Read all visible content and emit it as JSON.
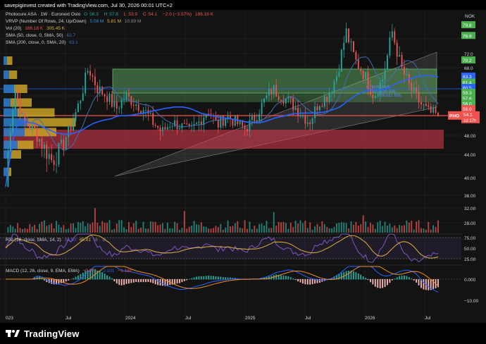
{
  "caption": "savepiginvest created with TradingView.com, Jul 30, 2026 00:01 UTC+2",
  "footer": {
    "brand": "TradingView"
  },
  "header": {
    "symbol": "Photocure ASA · 1W · Euronext Oslo",
    "ohlc": {
      "o_label": "O",
      "o": "56.3",
      "h_label": "H",
      "h": "57.8",
      "l_label": "L",
      "l": "53.9",
      "c_label": "C",
      "c": "54.1",
      "change": "−2.0 (−3.57%)",
      "vol": "186.18 K"
    },
    "vrvp": {
      "label": "VRVP (Number Of Rows, 24, Up/Down)",
      "v1": "5.08 M",
      "v2": "5.81 M",
      "v3": "10.89 M"
    },
    "vol": {
      "label": "Vol (20)",
      "v1": "186.18 K",
      "v2": "305.45 K"
    },
    "sma50": {
      "label": "SMA (50, close, 0, SMA, 50)",
      "value": "62.7"
    },
    "sma200": {
      "label": "SMA (200, close, 0, SMA, 20)",
      "value": "63.1"
    },
    "currency": "NOK"
  },
  "colors": {
    "up": "#26a69a",
    "down": "#ef5350",
    "blue": "#2962ff",
    "sma": "#3f6fb5",
    "orange": "#f0a030",
    "purple": "#7e57c2",
    "green_zone": "#66bb6a",
    "red_zone": "#e53950"
  },
  "price_labels": [
    {
      "value": 79.8,
      "text": "79.8",
      "color": "#4caf50"
    },
    {
      "value": 76.9,
      "text": "76.9",
      "color": "#4caf50"
    },
    {
      "value": 72.0,
      "text": "72.0",
      "color": null
    },
    {
      "value": 70.2,
      "text": "70.2",
      "color": "#4caf50"
    },
    {
      "value": 68.0,
      "text": "68.0",
      "color": null
    },
    {
      "value": 65.6,
      "text": "63.3",
      "color": "#2962ff"
    },
    {
      "value": 63.9,
      "text": "61.4",
      "color": "#4caf50"
    },
    {
      "value": 62.4,
      "text": "60.5",
      "color": "#2962ff"
    },
    {
      "value": 61.0,
      "text": "59.3",
      "color": "#4caf50"
    },
    {
      "value": 59.4,
      "text": "57.6",
      "color": "#4caf50"
    },
    {
      "value": 57.8,
      "text": "56.0",
      "color": "#4caf50"
    },
    {
      "value": 56.2,
      "text": "56.0",
      "color": "#ef5350"
    },
    {
      "value": 54.1,
      "text": "PHO",
      "color": "#ef5350",
      "tag": "54.1",
      "sub": "1d 17h"
    },
    {
      "value": 48.0,
      "text": "48.00",
      "color": null
    },
    {
      "value": 44.0,
      "text": "44.00",
      "color": null
    },
    {
      "value": 40.0,
      "text": "40.00",
      "color": null
    },
    {
      "value": 36.0,
      "text": "36.00",
      "color": null
    },
    {
      "value": 32.0,
      "text": "32.00",
      "color": null
    },
    {
      "value": 28.0,
      "text": "28.00",
      "color": null
    }
  ],
  "drawing_labels": [
    "0.786(59.908)",
    "0.786(59.908)",
    "0.882(57.956)"
  ],
  "x_labels": [
    "023",
    "Jul",
    "2024",
    "Jul",
    "2025",
    "Jul",
    "2026",
    "Jul"
  ],
  "rsi": {
    "label": "RSI (14, close, SMA, 14, 2)",
    "v1": "38.90",
    "v2": "45.81",
    "ticks": [
      "75.00",
      "50.00",
      "25.00"
    ]
  },
  "macd": {
    "label": "MACD (12, 26, close, 9, EMA, EMA)",
    "v1": "−0.971",
    "v2": "−2.101",
    "v3": "−1.130",
    "ticks": [
      "0.000",
      "−10.00"
    ]
  },
  "chart_data": {
    "type": "candlestick",
    "title": "Photocure ASA · 1W · Euronext Oslo",
    "x_range": [
      "2023",
      "Jul 2026"
    ],
    "y_range": [
      38,
      82
    ],
    "grid": true,
    "legend_placement": "top-left",
    "series": [
      {
        "name": "Photocure ASA",
        "close_path": [
          38.0,
          62.0,
          52.0,
          50.0,
          46.0,
          43.0,
          45.0,
          50.0,
          58.0,
          68.0,
          62.0,
          60.0,
          56.0,
          60.0,
          58.0,
          56.0,
          52.0,
          49.0,
          52.0,
          51.0,
          49.0,
          52.0,
          56.0,
          51.0,
          54.0,
          52.0,
          50.0,
          53.0,
          58.0,
          62.0,
          60.0,
          58.0,
          55.0,
          52.0,
          58.0,
          60.0,
          66.0,
          78.0,
          70.0,
          66.0,
          60.0,
          65.0,
          78.0,
          68.0,
          62.0,
          58.0,
          55.0,
          54.1
        ]
      },
      {
        "name": "SMA (50, close, 0, SMA, 50)",
        "last": 62.7
      },
      {
        "name": "SMA (200, close, 0, SMA, 20)",
        "last": 63.1
      }
    ],
    "volume": {
      "name": "Vol (20)",
      "last": 186180
    },
    "rsi": {
      "last": 38.9,
      "sma": 45.81
    },
    "macd": {
      "macd": -0.971,
      "signal": -2.101,
      "hist": -1.13
    }
  }
}
